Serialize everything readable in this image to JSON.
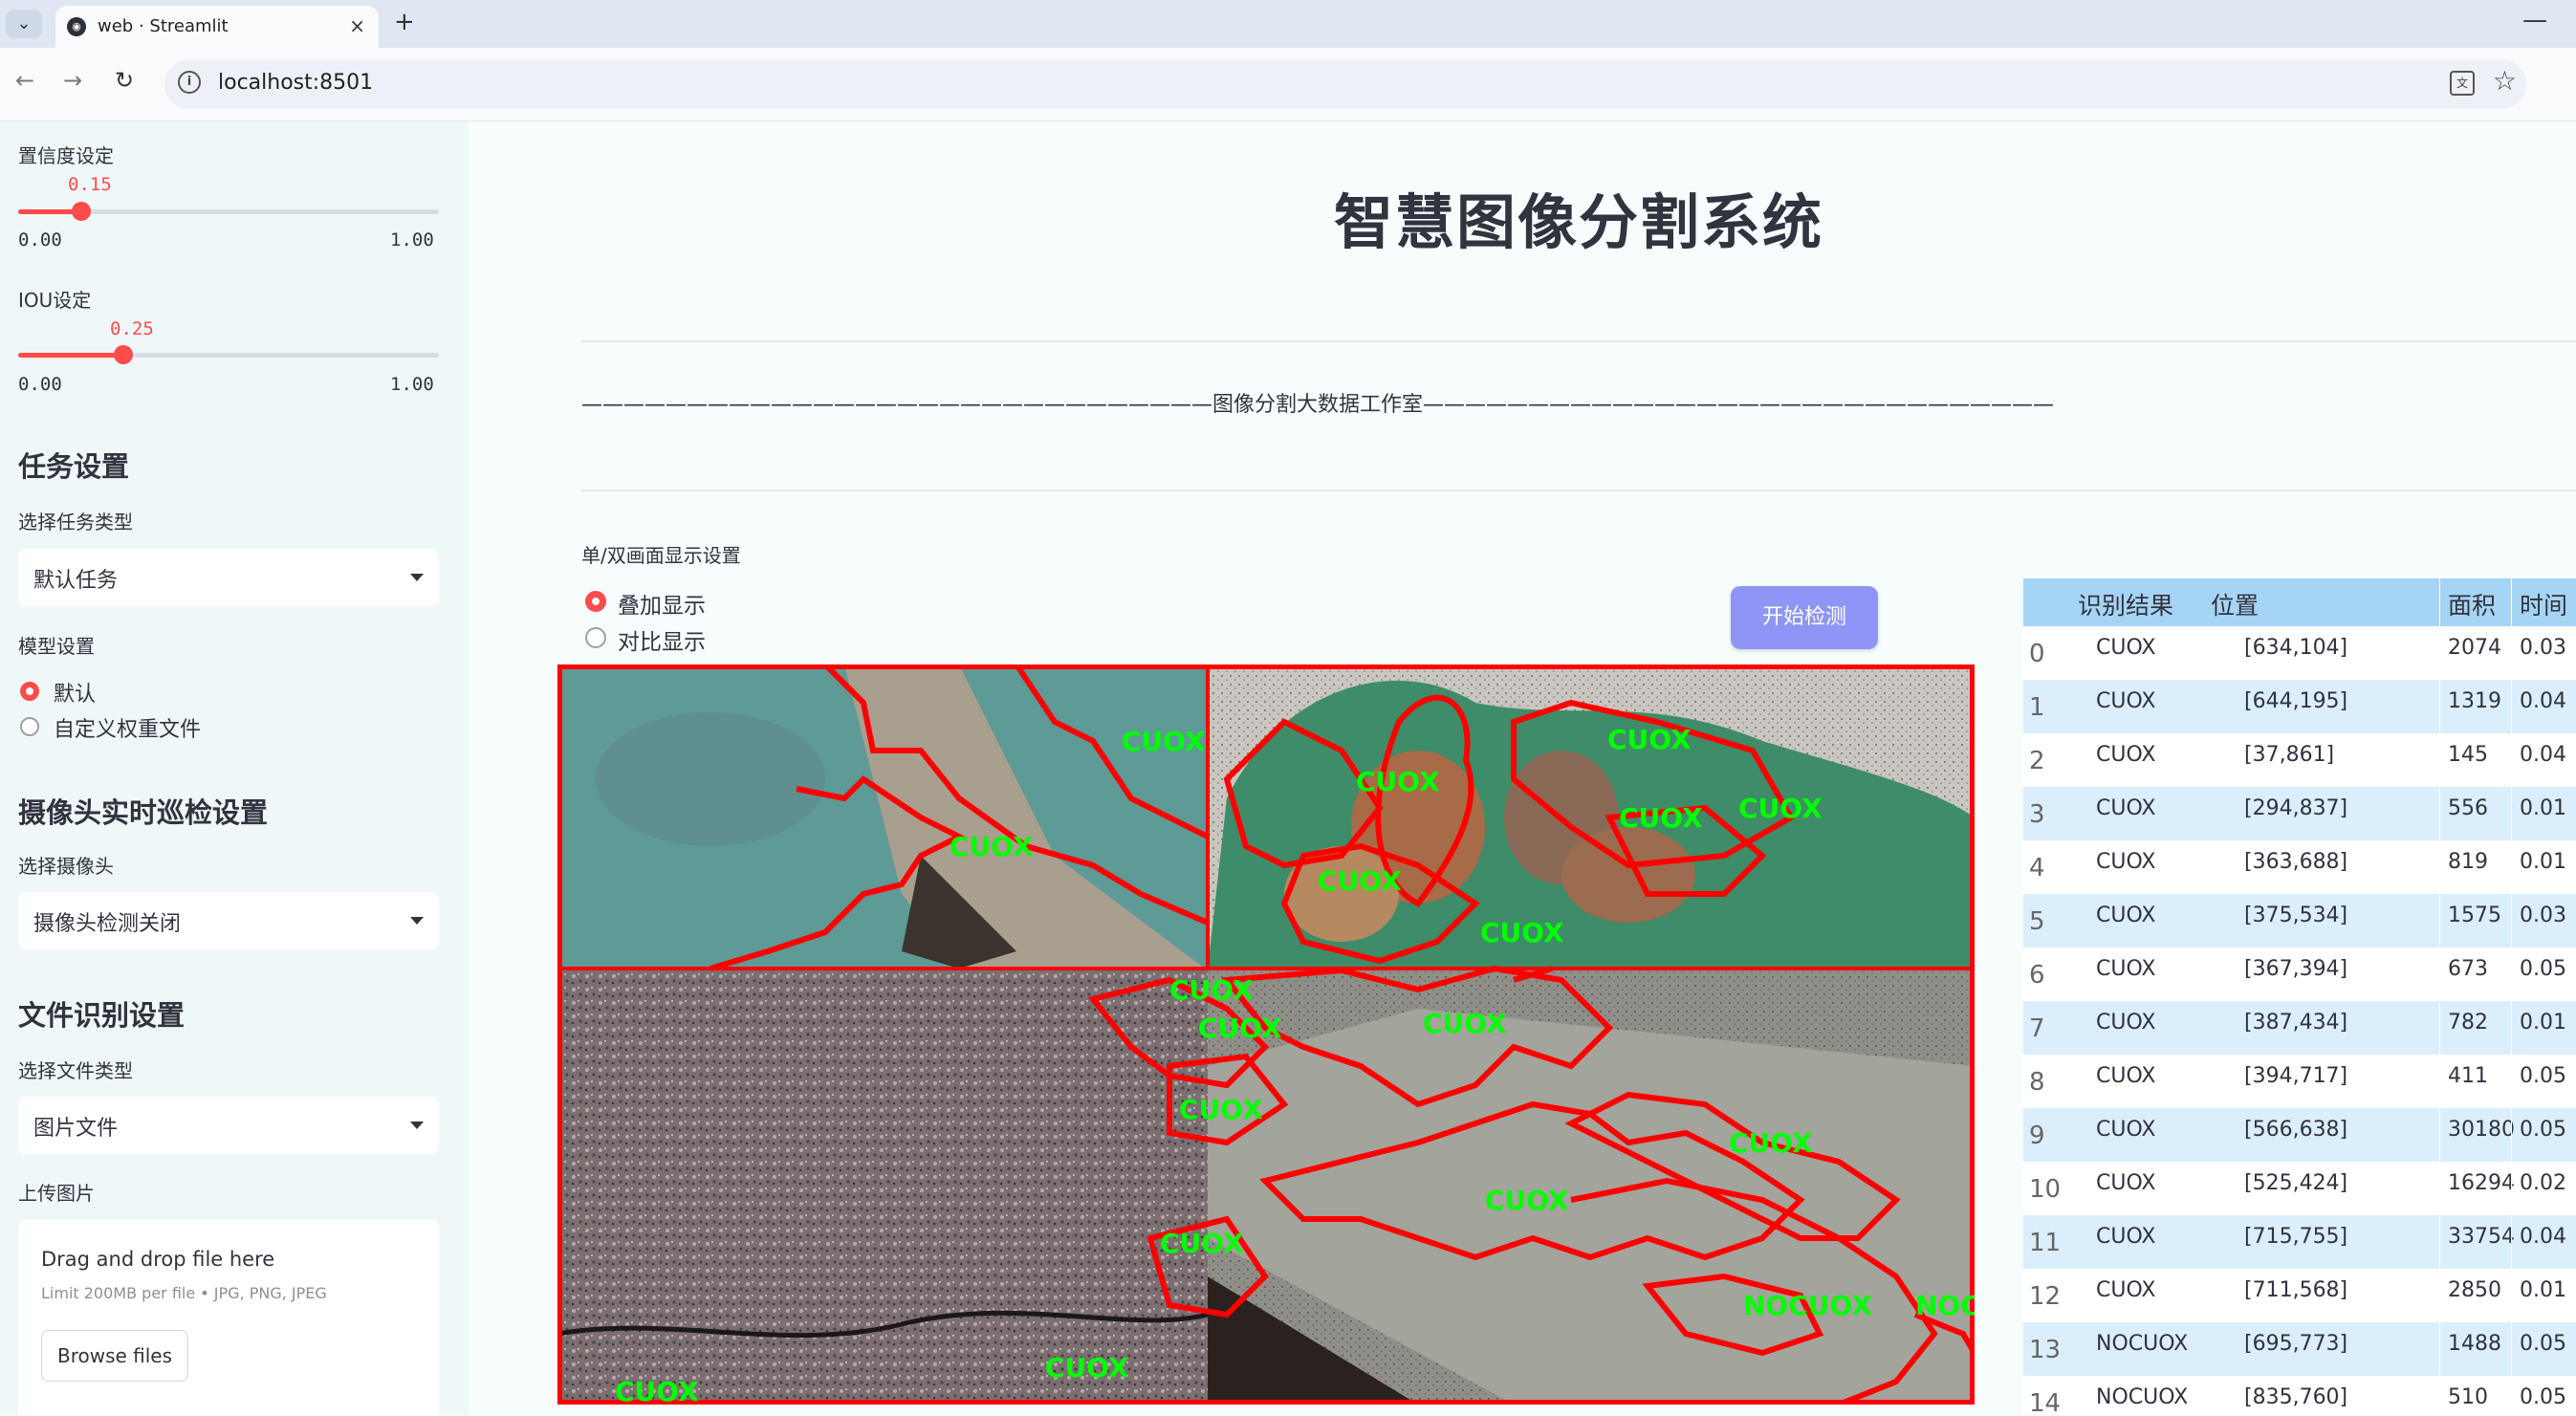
{
  "browser": {
    "tab_title": "web · Streamlit",
    "url": "localhost:8501",
    "new_tab_label": "+",
    "close_label": "×"
  },
  "sidebar": {
    "confidence": {
      "label": "置信度设定",
      "value": "0.15",
      "min": "0.00",
      "max": "1.00",
      "fraction": 0.15
    },
    "iou": {
      "label": "IOU设定",
      "value": "0.25",
      "min": "0.00",
      "max": "1.00",
      "fraction": 0.25
    },
    "task_section": "任务设置",
    "task_type_label": "选择任务类型",
    "task_type_value": "默认任务",
    "model_label": "模型设置",
    "model_options": [
      "默认",
      "自定义权重文件"
    ],
    "model_selected": 0,
    "camera_section": "摄像头实时巡检设置",
    "camera_label": "选择摄像头",
    "camera_value": "摄像头检测关闭",
    "file_section": "文件识别设置",
    "file_type_label": "选择文件类型",
    "file_type_value": "图片文件",
    "upload_label": "上传图片",
    "upload_title": "Drag and drop file here",
    "upload_limit": "Limit 200MB per file • JPG, PNG, JPEG",
    "browse_label": "Browse files"
  },
  "main": {
    "title": "智慧图像分割系统",
    "subtitle": "——————————————————————————————图像分割大数据工作室——————————————————————————————",
    "display_label": "单/双画面显示设置",
    "display_options": [
      "叠加显示",
      "对比显示"
    ],
    "display_selected": 0,
    "detect_button": "开始检测",
    "image_labels": [
      "CUOX",
      "NOCUOX"
    ]
  },
  "table": {
    "columns": [
      "识别结果",
      "位置",
      "面积",
      "时间"
    ],
    "rows": [
      {
        "i": "0",
        "cls": "CUOX",
        "pos": "[634,104]",
        "area": "2074",
        "time": "0.03"
      },
      {
        "i": "1",
        "cls": "CUOX",
        "pos": "[644,195]",
        "area": "1319",
        "time": "0.04"
      },
      {
        "i": "2",
        "cls": "CUOX",
        "pos": "[37,861]",
        "area": "145",
        "time": "0.04"
      },
      {
        "i": "3",
        "cls": "CUOX",
        "pos": "[294,837]",
        "area": "556",
        "time": "0.01"
      },
      {
        "i": "4",
        "cls": "CUOX",
        "pos": "[363,688]",
        "area": "819",
        "time": "0.01"
      },
      {
        "i": "5",
        "cls": "CUOX",
        "pos": "[375,534]",
        "area": "1575",
        "time": "0.03"
      },
      {
        "i": "6",
        "cls": "CUOX",
        "pos": "[367,394]",
        "area": "673",
        "time": "0.05"
      },
      {
        "i": "7",
        "cls": "CUOX",
        "pos": "[387,434]",
        "area": "782",
        "time": "0.01"
      },
      {
        "i": "8",
        "cls": "CUOX",
        "pos": "[394,717]",
        "area": "411",
        "time": "0.05"
      },
      {
        "i": "9",
        "cls": "CUOX",
        "pos": "[566,638]",
        "area": "30180",
        "time": "0.05"
      },
      {
        "i": "10",
        "cls": "CUOX",
        "pos": "[525,424]",
        "area": "16294",
        "time": "0.02"
      },
      {
        "i": "11",
        "cls": "CUOX",
        "pos": "[715,755]",
        "area": "33754",
        "time": "0.04"
      },
      {
        "i": "12",
        "cls": "CUOX",
        "pos": "[711,568]",
        "area": "2850",
        "time": "0.01"
      },
      {
        "i": "13",
        "cls": "NOCUOX",
        "pos": "[695,773]",
        "area": "1488",
        "time": "0.05"
      },
      {
        "i": "14",
        "cls": "NOCUOX",
        "pos": "[835,760]",
        "area": "510",
        "time": "0.05"
      }
    ]
  },
  "colors": {
    "accent": "#ff4b4b",
    "button": "#8f95f5",
    "table_header": "#a6d4f5",
    "table_alt_row": "#dbeefb",
    "mask_outline": "#ff0000",
    "label_text": "#00ff00"
  }
}
